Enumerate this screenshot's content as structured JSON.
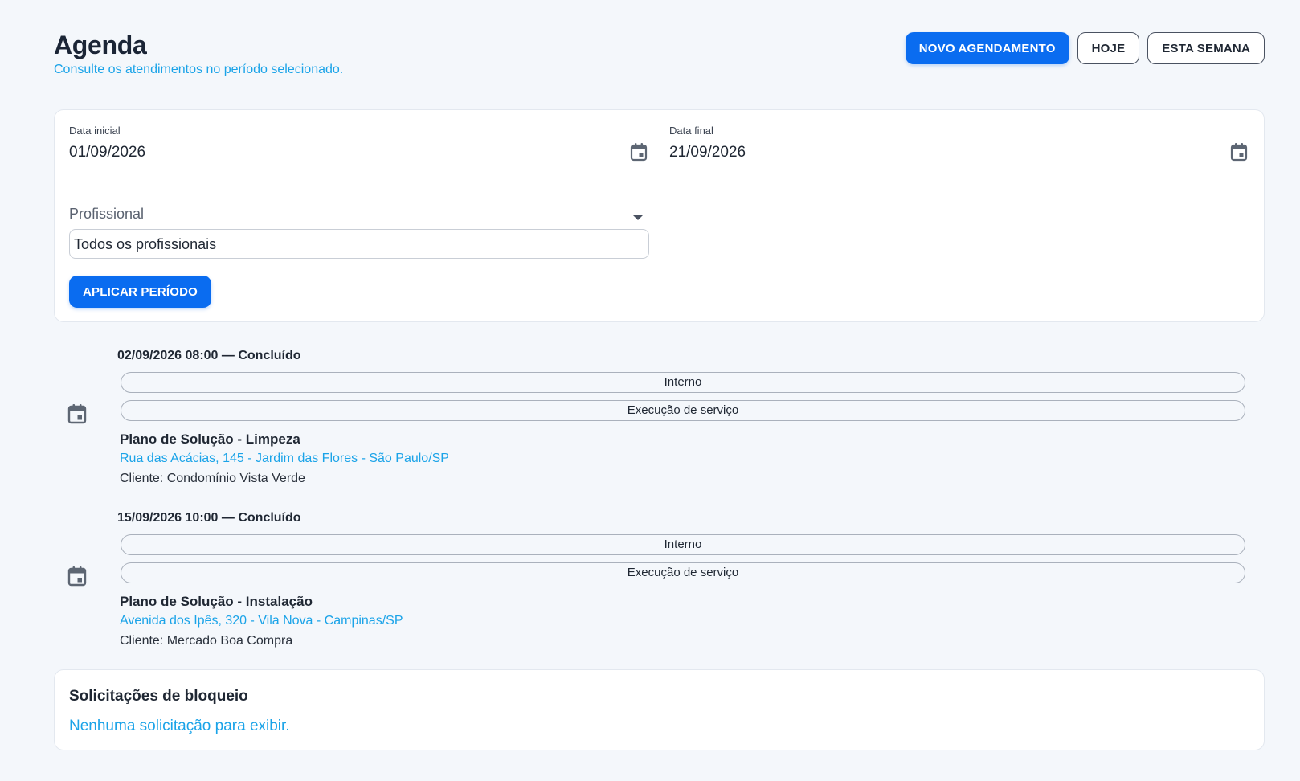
{
  "header": {
    "title": "Agenda",
    "subtitle": "Consulte os atendimentos no período selecionado.",
    "actions": {
      "new_appointment": "NOVO AGENDAMENTO",
      "today": "HOJE",
      "this_week": "ESTA SEMANA"
    }
  },
  "filters": {
    "start_date": {
      "label": "Data inicial",
      "value": "01/09/2026",
      "icon": "calendar-icon"
    },
    "end_date": {
      "label": "Data final",
      "value": "21/09/2026",
      "icon": "calendar-icon"
    },
    "professional": {
      "label": "Profissional",
      "value": "Todos os profissionais"
    },
    "apply_label": "APLICAR PERÍODO"
  },
  "appointments": [
    {
      "heading": "02/09/2026 08:00 — Concluído",
      "tags": [
        "Interno",
        "Execução de serviço"
      ],
      "plan": "Plano de Solução - Limpeza",
      "address": "Rua das Acácias, 145 - Jardim das Flores - São Paulo/SP",
      "client": "Cliente: Condomínio Vista Verde",
      "icon": "calendar-event-icon"
    },
    {
      "heading": "15/09/2026 10:00 — Concluído",
      "tags": [
        "Interno",
        "Execução de serviço"
      ],
      "plan": "Plano de Solução - Instalação",
      "address": "Avenida dos Ipês, 320 - Vila Nova - Campinas/SP",
      "client": "Cliente: Mercado Boa Compra",
      "icon": "calendar-event-icon"
    }
  ],
  "block_requests": {
    "title": "Solicitações de bloqueio",
    "empty_message": "Nenhuma solicitação para exibir."
  },
  "colors": {
    "primary": "#0a6cf0",
    "link": "#1aa3e8",
    "background": "#f4f7fb",
    "text": "#1f2733"
  }
}
